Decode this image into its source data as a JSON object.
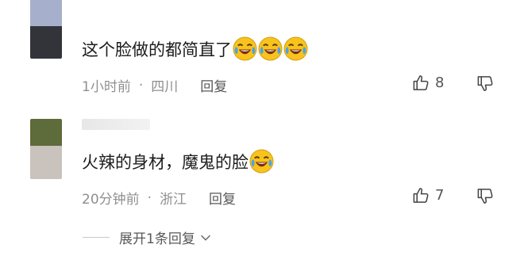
{
  "comments": [
    {
      "text": "这个脸做的都简直了",
      "emoji_count": 3,
      "time": "1小时前",
      "dot": "·",
      "location": "四川",
      "reply_label": "回复",
      "likes": "8",
      "avatar_colors": [
        "#a6b0cc",
        "#32343a"
      ]
    },
    {
      "text": "火辣的身材，魔鬼的脸",
      "emoji_count": 1,
      "time": "20分钟前",
      "dot": "·",
      "location": "浙江",
      "reply_label": "回复",
      "likes": "7",
      "avatar_colors": [
        "#5e6b3a",
        "#c9c2bd"
      ]
    }
  ],
  "expand_replies": {
    "label": "展开1条回复"
  },
  "icons": {
    "like": "thumbs-up-icon",
    "dislike": "thumbs-down-icon",
    "emoji": "crying-laughing-emoji-icon",
    "expand": "chevron-down-icon"
  },
  "colors": {
    "text": "#1c1c1c",
    "meta": "#8f8f8f",
    "reply": "#585858",
    "emoji_face": "#f7c31c"
  }
}
